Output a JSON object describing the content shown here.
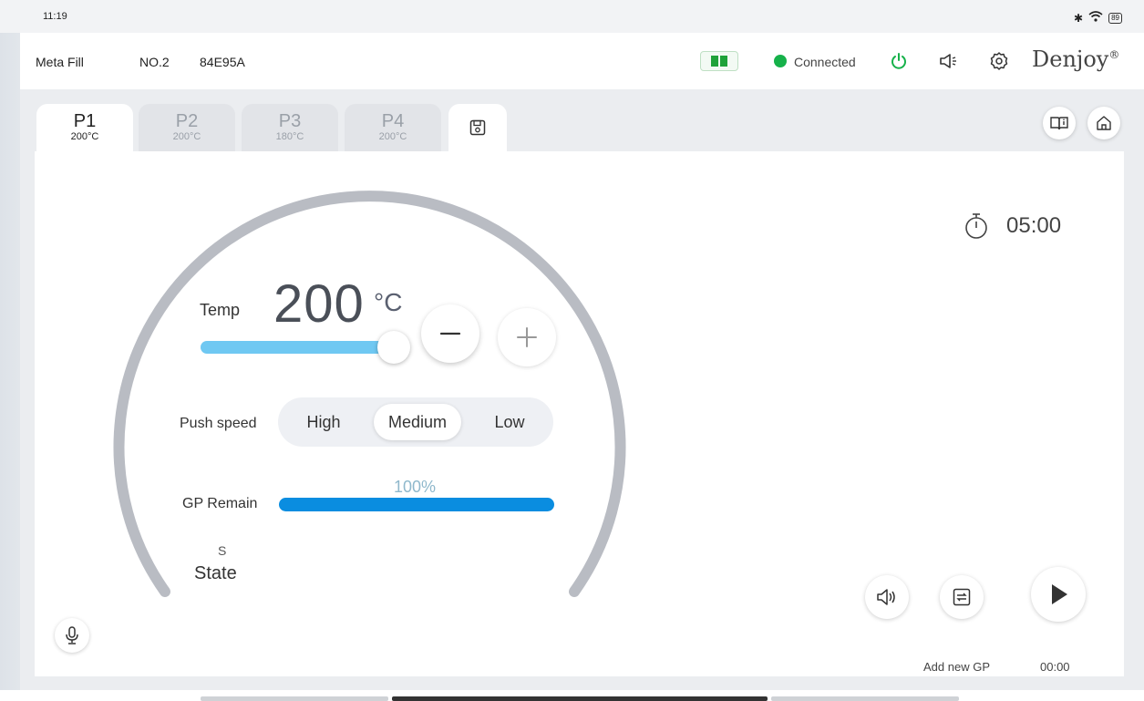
{
  "status_bar": {
    "time": "11:19",
    "battery": "89"
  },
  "header": {
    "app_name": "Meta Fill",
    "device_no": "NO.2",
    "device_id": "84E95A",
    "connection_status": "Connected",
    "connection_color": "#16b14a",
    "brand": "Denjoy",
    "brand_mark": "®"
  },
  "tabs": [
    {
      "name": "P1",
      "temp": "200°C",
      "active": true
    },
    {
      "name": "P2",
      "temp": "200°C",
      "active": false
    },
    {
      "name": "P3",
      "temp": "180°C",
      "active": false
    },
    {
      "name": "P4",
      "temp": "200°C",
      "active": false
    }
  ],
  "temperature": {
    "label": "Temp",
    "value": "200",
    "unit": "°C",
    "slider_fraction": 0.95
  },
  "push_speed": {
    "label": "Push speed",
    "options": [
      "High",
      "Medium",
      "Low"
    ],
    "selected": "Medium"
  },
  "gp_remain": {
    "label": "GP Remain",
    "percent_text": "100%",
    "percent": 100
  },
  "state": {
    "symbol": "S",
    "label": "State"
  },
  "timer": {
    "value": "05:00"
  },
  "actions": {
    "add_gp_label": "Add new GP",
    "play_time": "00:00"
  },
  "colors": {
    "accent": "#0a8de0",
    "slider": "#6fc8f2",
    "arc": "#b9bcc3"
  }
}
